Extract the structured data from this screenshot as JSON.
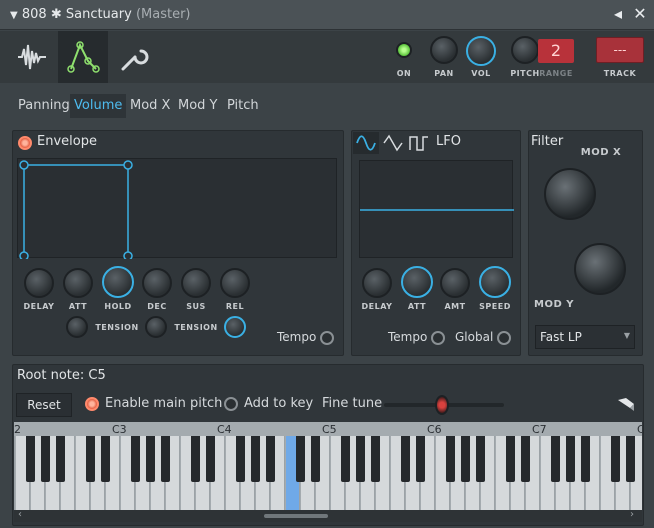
{
  "window": {
    "title": "808",
    "gear_glyph": "✱",
    "channel": "Sanctuary",
    "master": "(Master)",
    "menu_glyph": "▼",
    "pin_glyph": "◂",
    "close_glyph": "✕"
  },
  "toolbar": {
    "tabs": [
      {
        "icon": "waveform-icon"
      },
      {
        "icon": "envelope-icon"
      },
      {
        "icon": "wrench-icon"
      }
    ],
    "on_label": "ON",
    "pan_label": "PAN",
    "vol_label": "VOL",
    "pitch_label": "PITCH",
    "range_label": "RANGE",
    "range_value": "2",
    "track_label": "TRACK",
    "track_value": "---"
  },
  "subtabs": [
    "Panning",
    "Volume",
    "Mod X",
    "Mod Y",
    "Pitch"
  ],
  "envelope": {
    "label": "Envelope",
    "knobs": [
      "DELAY",
      "ATT",
      "HOLD",
      "DEC",
      "SUS",
      "REL"
    ],
    "tension_label": "TENSION",
    "tempo_label": "Tempo"
  },
  "lfo": {
    "label": "LFO",
    "knobs": [
      "DELAY",
      "ATT",
      "AMT",
      "SPEED"
    ],
    "tempo_label": "Tempo",
    "global_label": "Global"
  },
  "filter": {
    "label": "Filter",
    "mod_x_label": "MOD X",
    "mod_y_label": "MOD Y",
    "type_value": "Fast LP"
  },
  "root": {
    "label": "Root note: C5",
    "reset_label": "Reset",
    "enable_pitch_label": "Enable main pitch",
    "add_to_key_label": "Add to key",
    "fine_tune_label": "Fine tune"
  },
  "keyboard": {
    "octave_labels": [
      "2",
      "C3",
      "C4",
      "C5",
      "C6",
      "C7",
      "C"
    ],
    "highlight_color": "#6fa9e8"
  },
  "colors": {
    "accent": "#3ab0e4",
    "range_box": "#b8323a",
    "track_box": "#a8323a",
    "on_led": "#7be05a"
  }
}
